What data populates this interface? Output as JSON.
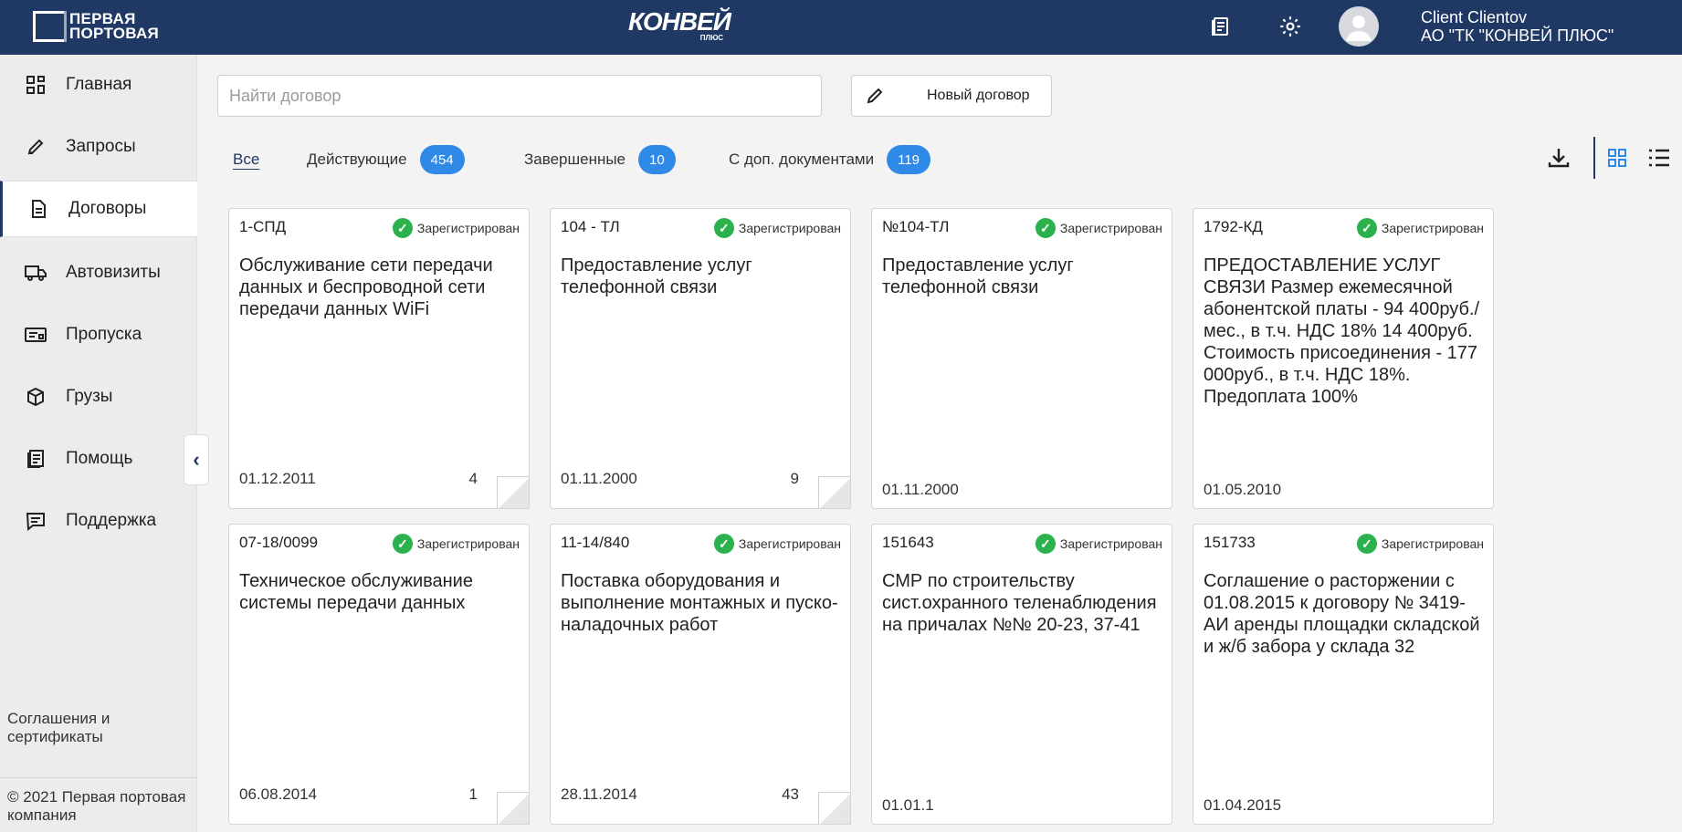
{
  "header": {
    "logo_left": "ПЕРВАЯ ПОРТОВАЯ",
    "logo_center_main": "КОНВЕЙ",
    "logo_center_sub": "ПЛЮС",
    "user_name": "Client Clientov",
    "company": "АО \"ТК \"КОНВЕЙ ПЛЮС\""
  },
  "sidebar": {
    "items": [
      {
        "label": "Главная",
        "icon": "dashboard-icon"
      },
      {
        "label": "Запросы",
        "icon": "pencil-icon"
      },
      {
        "label": "Договоры",
        "icon": "document-icon"
      },
      {
        "label": "Автовизиты",
        "icon": "truck-icon"
      },
      {
        "label": "Пропуска",
        "icon": "pass-card-icon"
      },
      {
        "label": "Грузы",
        "icon": "box-icon"
      },
      {
        "label": "Помощь",
        "icon": "help-book-icon"
      },
      {
        "label": "Поддержка",
        "icon": "chat-icon"
      }
    ],
    "active": "Договоры",
    "collapse_glyph": "‹",
    "footer_link": "Соглашения и сертификаты",
    "copyright": "© 2021 Первая портовая компания"
  },
  "search": {
    "placeholder": "Найти договор",
    "value": ""
  },
  "new_contract_label": "Новый договор",
  "filters": [
    {
      "label": "Все",
      "count": null
    },
    {
      "label": "Действующие",
      "count": "454"
    },
    {
      "label": "Завершенные",
      "count": "10"
    },
    {
      "label": "С доп. документами",
      "count": "119"
    }
  ],
  "colors": {
    "header_bg": "#1f3864",
    "badge_bg": "#2f89e6",
    "status_ok": "#2bb24c"
  },
  "cards": [
    {
      "number": "1-СПД",
      "status": "Зарегистрирован",
      "title": "Обслуживание сети передачи данных и беспроводной сети передачи данных WiFi",
      "date": "01.12.2011",
      "docs": "4"
    },
    {
      "number": "104 - ТЛ",
      "status": "Зарегистрирован",
      "title": "Предоставление услуг телефонной связи",
      "date": "01.11.2000",
      "docs": "9"
    },
    {
      "number": "№104-ТЛ",
      "status": "Зарегистрирован",
      "title": "Предоставление услуг телефонной связи",
      "date": "01.11.2000",
      "docs": ""
    },
    {
      "number": "1792-КД",
      "status": "Зарегистрирован",
      "title": "ПРЕДОСТАВЛЕНИЕ УСЛУГ СВЯЗИ Размер ежемесячной абонентской платы - 94 400руб./мес., в т.ч. НДС 18% 14 400руб. Стоимость присоединения - 177 000руб., в т.ч. НДС 18%. Предоплата 100%",
      "date": "01.05.2010",
      "docs": ""
    },
    {
      "number": "07-18/0099",
      "status": "Зарегистрирован",
      "title": "Техническое обслуживание системы передачи данных",
      "date": "06.08.2014",
      "docs": "1"
    },
    {
      "number": "11-14/840",
      "status": "Зарегистрирован",
      "title": "Поставка оборудования и выполнение монтажных и пуско-наладочных работ",
      "date": "28.11.2014",
      "docs": "43"
    },
    {
      "number": "151643",
      "status": "Зарегистрирован",
      "title": "СМР по строительству сист.охранного теленаблюдения на причалах №№ 20-23, 37-41",
      "date": "01.01.1",
      "docs": ""
    },
    {
      "number": "151733",
      "status": "Зарегистрирован",
      "title": "Соглашение о расторжении с 01.08.2015 к договору № 3419-АИ аренды площадки складской и ж/б забора у склада 32",
      "date": "01.04.2015",
      "docs": ""
    }
  ]
}
